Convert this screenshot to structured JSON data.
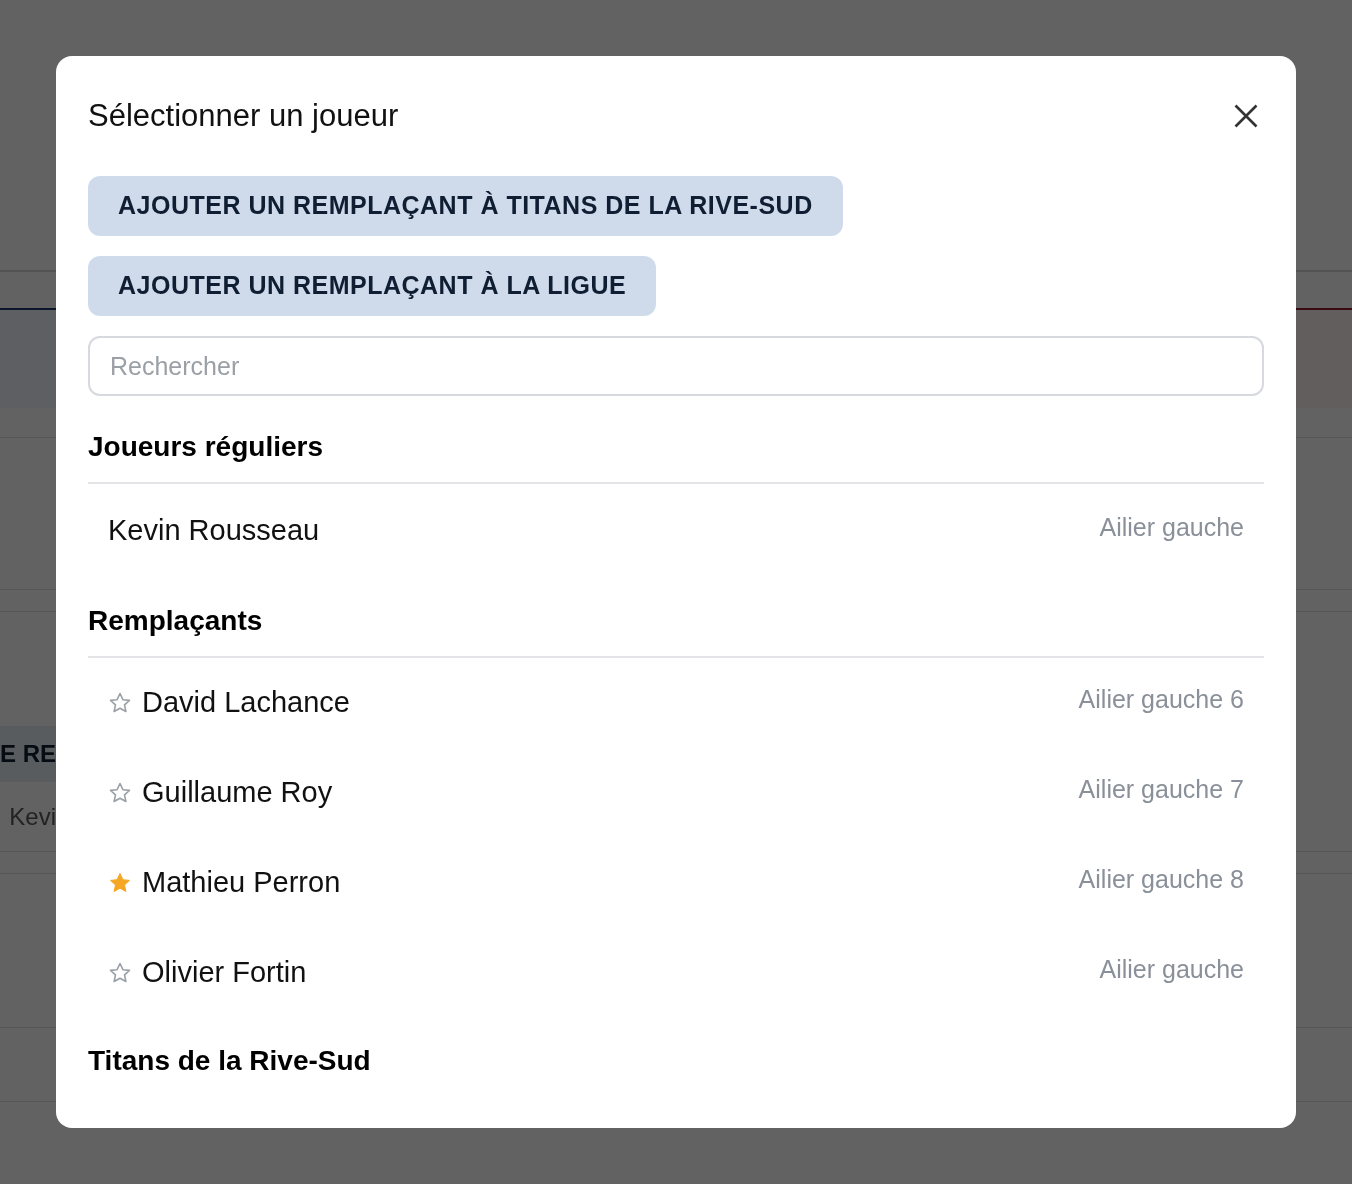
{
  "background": {
    "banner_text": "E RE",
    "row_text": "Kevi"
  },
  "dialog": {
    "title": "Sélectionner un joueur",
    "buttons": [
      "AJOUTER UN REMPLAÇANT À TITANS DE LA RIVE-SUD",
      "AJOUTER UN REMPLAÇANT À LA LIGUE"
    ],
    "search": {
      "placeholder": "Rechercher"
    },
    "sections": [
      {
        "title": "Joueurs réguliers",
        "players": [
          {
            "name": "Kevin Rousseau",
            "position": "Ailier gauche"
          }
        ]
      },
      {
        "title": "Remplaçants",
        "players": [
          {
            "name": "David Lachance",
            "position": "Ailier gauche 6",
            "starred": false
          },
          {
            "name": "Guillaume Roy",
            "position": "Ailier gauche 7",
            "starred": false
          },
          {
            "name": "Mathieu Perron",
            "position": "Ailier gauche 8",
            "starred": true
          },
          {
            "name": "Olivier Fortin",
            "position": "Ailier gauche",
            "starred": false
          }
        ]
      },
      {
        "title": "Titans de la Rive-Sud"
      }
    ]
  }
}
